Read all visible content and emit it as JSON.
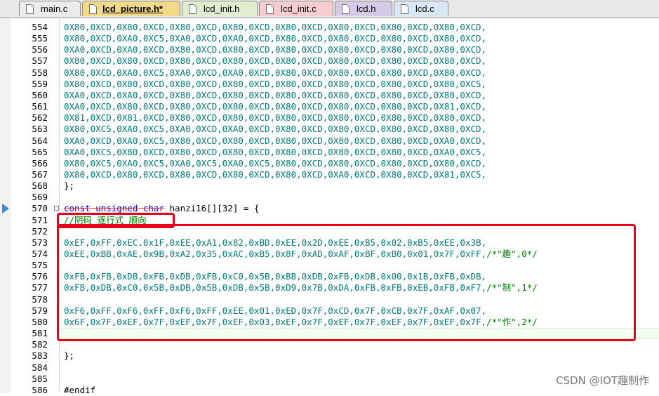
{
  "tabs": [
    {
      "label": "main.c",
      "color": "#ececec"
    },
    {
      "label": "lcd_picture.h*",
      "color": "#f3d98a"
    },
    {
      "label": "lcd_init.h",
      "color": "#e2edcf"
    },
    {
      "label": "lcd_init.c",
      "color": "#f7cdd2"
    },
    {
      "label": "lcd.h",
      "color": "#d6cbe6"
    },
    {
      "label": "lcd.c",
      "color": "#d9e6f3"
    }
  ],
  "lines": [
    {
      "n": "554",
      "t": "0X80,0XCD,0X80,0XCD,0X80,0XCD,0X80,0XCD,0X80,0XCD,0X80,0XCD,0X80,0XCD,0X80,0XCD,"
    },
    {
      "n": "555",
      "t": "0X80,0XCD,0XA0,0XC5,0XA0,0XCD,0XA0,0XCD,0X80,0XCD,0X80,0XCD,0X80,0XCD,0X80,0XCD,"
    },
    {
      "n": "556",
      "t": "0XA0,0XCD,0XA0,0XCD,0X80,0XCD,0X80,0XCD,0X80,0XCD,0X80,0XCD,0X80,0XCD,0X80,0XCD,"
    },
    {
      "n": "557",
      "t": "0X80,0XCD,0X80,0XCD,0X80,0XCD,0X80,0XCD,0X80,0XCD,0X80,0XCD,0X80,0XCD,0X80,0XCD,"
    },
    {
      "n": "558",
      "t": "0X80,0XCD,0XA0,0XC5,0XA0,0XCD,0XA0,0XCD,0X80,0XCD,0X80,0XCD,0X80,0XCD,0X80,0XCD,"
    },
    {
      "n": "559",
      "t": "0X80,0XCD,0X80,0XCD,0X80,0XCD,0X80,0XCD,0X80,0XCD,0X80,0XCD,0X80,0XCD,0X80,0XC5,"
    },
    {
      "n": "560",
      "t": "0XA0,0XCD,0XA0,0XCD,0X80,0XCD,0X80,0XCD,0X80,0XCD,0X80,0XCD,0X80,0XCD,0X80,0XCD,"
    },
    {
      "n": "561",
      "t": "0XA0,0XCD,0X80,0XCD,0X80,0XCD,0X80,0XCD,0X80,0XCD,0X80,0XCD,0X80,0XCD,0X81,0XCD,"
    },
    {
      "n": "562",
      "t": "0X81,0XCD,0X81,0XCD,0X80,0XCD,0X80,0XCD,0X80,0XCD,0X80,0XCD,0X80,0XCD,0X80,0XCD,"
    },
    {
      "n": "563",
      "t": "0X80,0XC5,0XA0,0XC5,0XA0,0XCD,0XA0,0XCD,0X80,0XCD,0X80,0XCD,0X80,0XCD,0X80,0XCD,"
    },
    {
      "n": "564",
      "t": "0XA0,0XCD,0XA0,0XC5,0X80,0XCD,0X80,0XCD,0X80,0XCD,0X80,0XCD,0X80,0XCD,0XA0,0XCD,"
    },
    {
      "n": "565",
      "t": "0XA0,0XC5,0X80,0XCD,0X80,0XCD,0X80,0XCD,0X80,0XCD,0X80,0XCD,0X80,0XCD,0XA0,0XC5,"
    },
    {
      "n": "566",
      "t": "0X80,0XC5,0XA0,0XC5,0XA0,0XC5,0XA0,0XC5,0X80,0XCD,0X80,0XCD,0X80,0XCD,0X80,0XCD,"
    },
    {
      "n": "567",
      "t": "0X80,0XCD,0X80,0XCD,0X80,0XCD,0X80,0XCD,0X80,0XCD,0XA0,0XCD,0X80,0XCD,0X81,0XC5,"
    },
    {
      "n": "568",
      "t": "};"
    },
    {
      "n": "569",
      "t": ""
    },
    {
      "n": "570",
      "t1": "const unsigned char",
      "t2": " hanzi16[][32] = {"
    },
    {
      "n": "571",
      "t": "//阴码 逐行式 顺向"
    },
    {
      "n": "572",
      "t": ""
    },
    {
      "n": "573",
      "t": "0xEF,0xFF,0xEC,0x1F,0xEE,0xA1,0x82,0xBD,0xEE,0x2D,0xEE,0xB5,0x02,0xB5,0xEE,0x3B,"
    },
    {
      "n": "574",
      "t": "0xEE,0xBB,0xAE,0x9B,0xA2,0x35,0xAC,0xB5,0x8F,0xAD,0xAF,0xBF,0xB0,0x01,0x7F,0xFF,",
      "c": "/*\"趣\",0*/"
    },
    {
      "n": "575",
      "t": ""
    },
    {
      "n": "576",
      "t": "0xFB,0xFB,0xDB,0xFB,0xDB,0xFB,0xC0,0x5B,0xBB,0xDB,0xFB,0xDB,0x00,0x1B,0xFB,0xDB,"
    },
    {
      "n": "577",
      "t": "0xFB,0xDB,0xC0,0x5B,0xDB,0x5B,0xDB,0x5B,0xD9,0x7B,0xDA,0xFB,0xFB,0xEB,0xFB,0xF7,",
      "c": "/*\"制\",1*/"
    },
    {
      "n": "578",
      "t": ""
    },
    {
      "n": "579",
      "t": "0xF6,0xFF,0xF6,0xFF,0xF6,0xFF,0xEE,0x01,0xED,0x7F,0xCD,0x7F,0xCB,0x7F,0xAF,0x07,"
    },
    {
      "n": "580",
      "t": "0x6F,0x7F,0xEF,0x7F,0xEF,0x7F,0xEF,0x03,0xEF,0x7F,0xEF,0x7F,0xEF,0x7F,0xEF,0x7F,",
      "c": "/*\"作\",2*/"
    },
    {
      "n": "581",
      "t": ""
    },
    {
      "n": "582",
      "t": ""
    },
    {
      "n": "583",
      "t": "};"
    },
    {
      "n": "584",
      "t": ""
    },
    {
      "n": "585",
      "t": ""
    },
    {
      "n": "586",
      "t": "#endif"
    }
  ],
  "watermark": "CSDN @IOT趣制作"
}
